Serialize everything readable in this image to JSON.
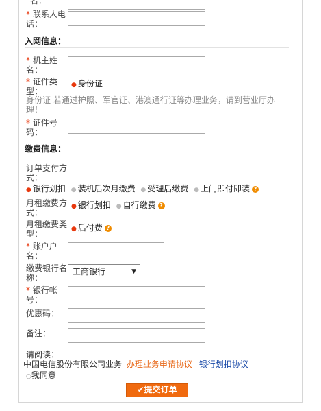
{
  "top": {
    "name_label_tail": "名：",
    "contact_phone_label": "联系人电话："
  },
  "network_section": {
    "title": "入网信息：",
    "owner_name_label": "机主姓名：",
    "id_type_label": "证件类型：",
    "id_type_option": "身份证",
    "id_note": "身份证 若通过护照、军官证、港澳通行证等办理业务，请到营业厅办理！",
    "id_number_label": "证件号码："
  },
  "payment_section": {
    "title": "缴费信息：",
    "order_payment_label": "订单支付方式：",
    "order_payment_options": [
      "银行划扣",
      "装机后次月缴费",
      "受理后缴费",
      "上门即付即装"
    ],
    "monthly_method_label": "月租缴费方式：",
    "monthly_method_options": [
      "银行划扣",
      "自行缴费"
    ],
    "monthly_type_label": "月租缴费类型：",
    "monthly_type_option": "后付费",
    "account_name_label": "账户户名：",
    "bank_name_label": "缴费银行名称：",
    "bank_selected": "工商银行",
    "bank_account_label": "银行帐号：",
    "promo_label": "优惠码：",
    "remark_label": "备注："
  },
  "agreement": {
    "please_read": "请阅读：",
    "company_text": "中国电信股份有限公司业务",
    "link1": "办理业务申请协议",
    "link2": "银行划扣协议",
    "agree_label": "我同意"
  },
  "submit_label": "提交订单",
  "colors": {
    "accent": "#f06a0f",
    "required": "#e8380d",
    "link_blue": "#1a4aa8"
  }
}
